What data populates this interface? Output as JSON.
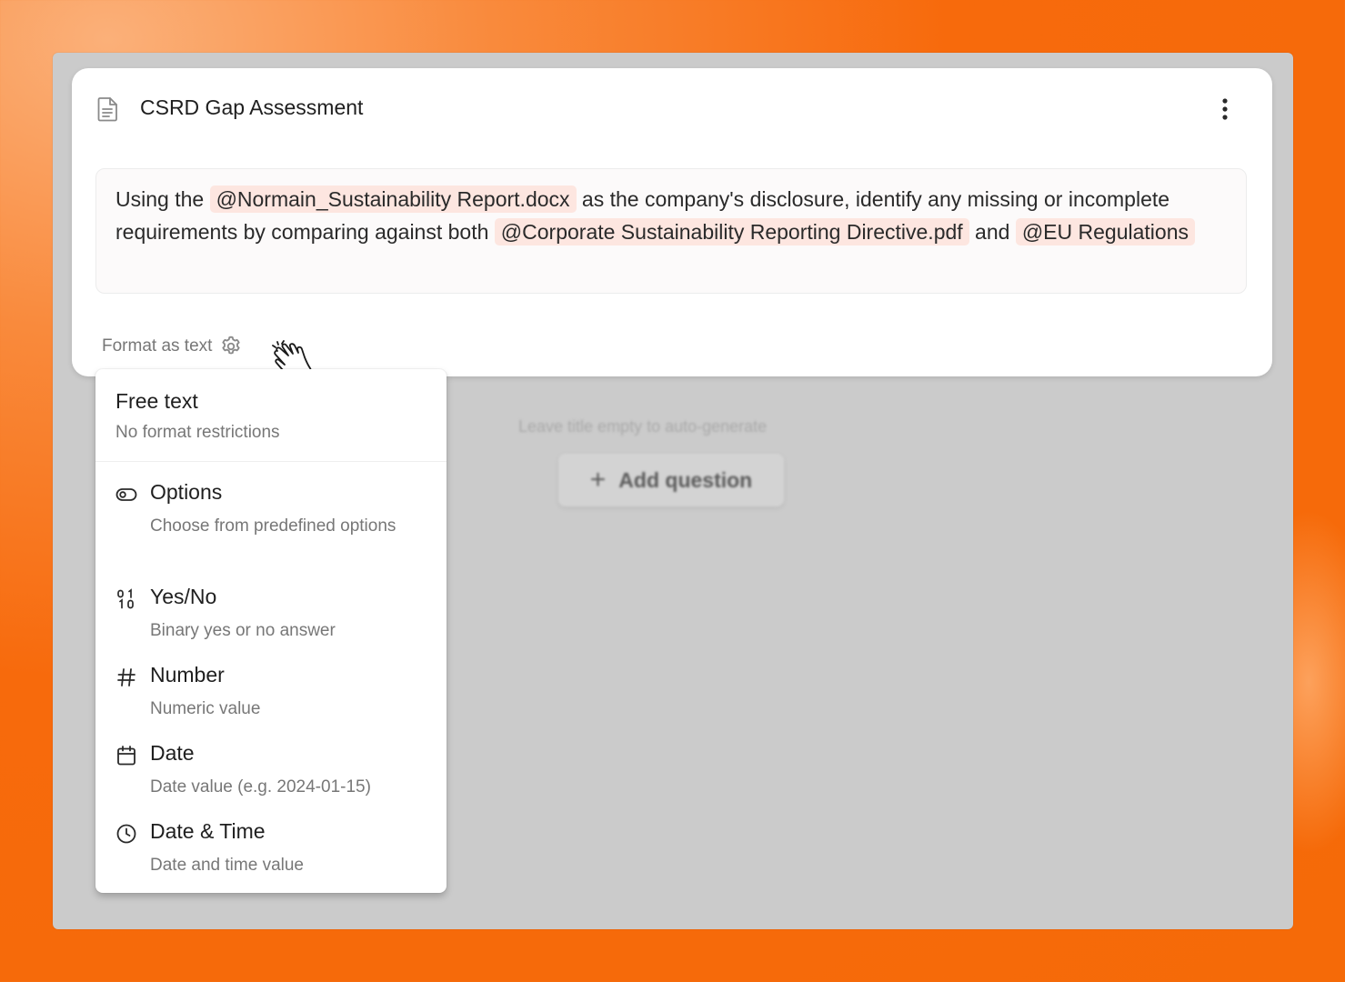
{
  "card": {
    "title": "CSRD Gap Assessment",
    "prompt": {
      "text_1": "Using the ",
      "mention_1": "@Normain_Sustainability Report.docx",
      "text_2": " as the company's disclosure, identify any missing or incomplete requirements by comparing against both ",
      "mention_2": "@Corporate Sustainability Reporting Directive.pdf",
      "text_3": " and ",
      "mention_3": "@EU Regulations"
    },
    "format_label": "Format as text"
  },
  "background": {
    "hint": "Leave title empty to auto-generate",
    "add_question_label": "Add question"
  },
  "format_menu": {
    "free_text": {
      "title": "Free text",
      "description": "No format restrictions"
    },
    "items": [
      {
        "icon": "options-icon",
        "title": "Options",
        "description": "Choose from predefined options"
      },
      {
        "icon": "binary-icon",
        "title": "Yes/No",
        "description": "Binary yes or no answer"
      },
      {
        "icon": "hash-icon",
        "title": "Number",
        "description": "Numeric value"
      },
      {
        "icon": "calendar-icon",
        "title": "Date",
        "description": "Date value (e.g. 2024-01-15)"
      },
      {
        "icon": "clock-icon",
        "title": "Date & Time",
        "description": "Date and time value"
      }
    ]
  },
  "colors": {
    "background_orange": "#f76a0c",
    "mention_bg": "#fde6e0",
    "overlay_gray": "#cbcbcb"
  }
}
